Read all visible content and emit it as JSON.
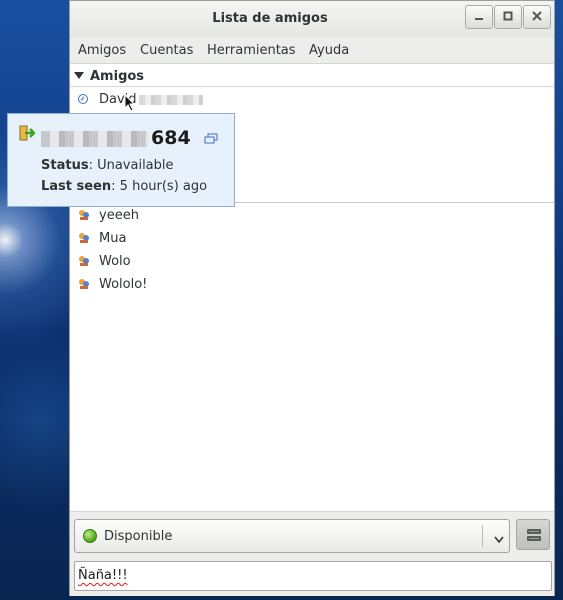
{
  "window": {
    "title": "Lista de amigos"
  },
  "menu": [
    "Amigos",
    "Cuentas",
    "Herramientas",
    "Ayuda"
  ],
  "buddy_list": {
    "group": "Amigos",
    "first_buddy": {
      "name": "David",
      "icon": "clock-icon"
    },
    "buddies": [
      {
        "name": "yeeeh",
        "icon": "group-chat-icon"
      },
      {
        "name": "Mua",
        "icon": "group-chat-icon"
      },
      {
        "name": "Wolo",
        "icon": "group-chat-icon"
      },
      {
        "name": "Wololo!",
        "icon": "group-chat-icon"
      }
    ]
  },
  "tooltip": {
    "name_suffix": "684",
    "status_label": "Status",
    "status_value": ": Unavailable",
    "last_seen_label": "Last seen",
    "last_seen_value": ": 5 hour(s) ago"
  },
  "status_bar": {
    "status": "Disponible",
    "status_color": "#4ea31c",
    "message": "Ñaña!!!"
  }
}
